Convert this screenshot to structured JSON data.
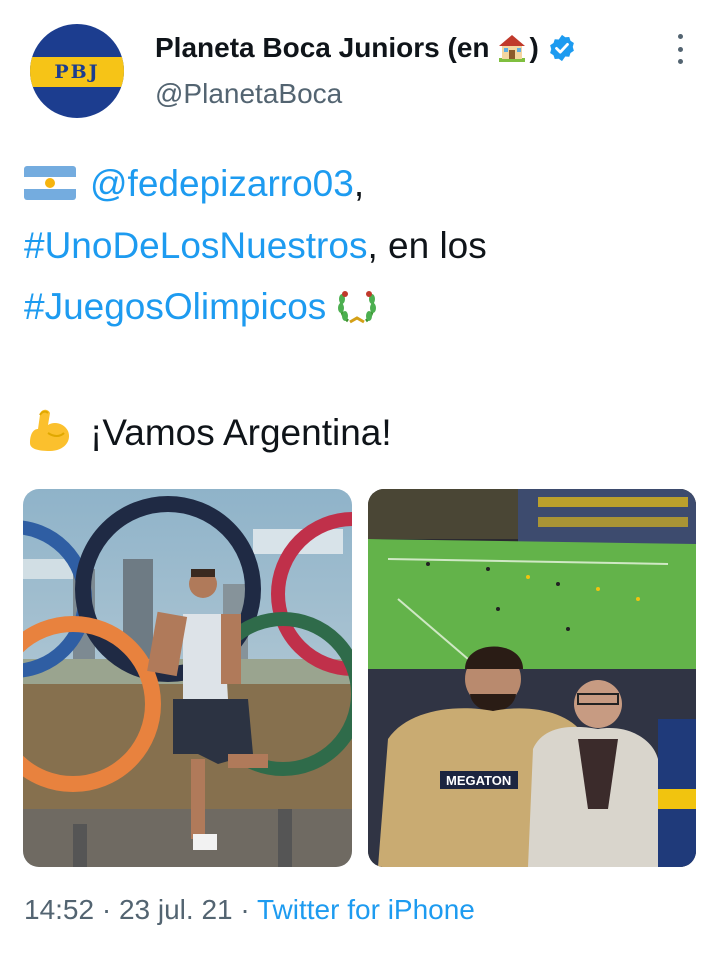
{
  "author": {
    "avatar_text": "PBJ",
    "display_name": "Planeta Boca Juniors (en",
    "display_name_end": ")",
    "house_emoji": "house-emoji",
    "handle": "@PlanetaBoca",
    "verified": true
  },
  "tweet": {
    "mention": "@fedepizarro03",
    "comma": ",",
    "hashtag1": "#UnoDeLosNuestros",
    "text_after_hashtag1": ", en los",
    "hashtag2": "#JuegosOlimpicos",
    "closing": "¡Vamos Argentina!"
  },
  "media": [
    {
      "name": "olympic-rings-photo"
    },
    {
      "name": "stadium-photo",
      "shirt_text": "MEGATON"
    }
  ],
  "meta": {
    "time": "14:52",
    "separator1": " · ",
    "date": "23 jul. 21",
    "separator2": " · ",
    "source": "Twitter for iPhone"
  },
  "colors": {
    "link": "#1d9bf0",
    "text": "#0f1419",
    "secondary": "#536471"
  }
}
